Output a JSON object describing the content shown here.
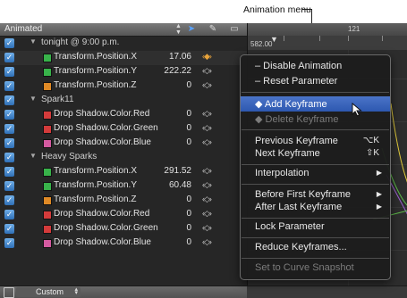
{
  "callout": {
    "label": "Animation menu"
  },
  "header": {
    "filter": "Animated"
  },
  "ruler": {
    "labels": [
      "",
      "121"
    ],
    "readout": "582.00"
  },
  "rows": [
    {
      "type": "group",
      "name": "tonight @ 9:00 p.m."
    },
    {
      "type": "param",
      "name": "Transform.Position.X",
      "value": "17.06",
      "color": "#38b34a",
      "keyframe_active": true
    },
    {
      "type": "param",
      "name": "Transform.Position.Y",
      "value": "222.22",
      "color": "#38b34a"
    },
    {
      "type": "param",
      "name": "Transform.Position.Z",
      "value": "0",
      "color": "#e08a26"
    },
    {
      "type": "group",
      "name": "Spark11"
    },
    {
      "type": "param",
      "name": "Drop Shadow.Color.Red",
      "value": "0",
      "color": "#d43b3b"
    },
    {
      "type": "param",
      "name": "Drop Shadow.Color.Green",
      "value": "0",
      "color": "#d43b3b"
    },
    {
      "type": "param",
      "name": "Drop Shadow.Color.Blue",
      "value": "0",
      "color": "#d45aa0"
    },
    {
      "type": "group",
      "name": "Heavy Sparks"
    },
    {
      "type": "param",
      "name": "Transform.Position.X",
      "value": "291.52",
      "color": "#38b34a"
    },
    {
      "type": "param",
      "name": "Transform.Position.Y",
      "value": "60.48",
      "color": "#38b34a"
    },
    {
      "type": "param",
      "name": "Transform.Position.Z",
      "value": "0",
      "color": "#e08a26"
    },
    {
      "type": "param",
      "name": "Drop Shadow.Color.Red",
      "value": "0",
      "color": "#d43b3b"
    },
    {
      "type": "param",
      "name": "Drop Shadow.Color.Green",
      "value": "0",
      "color": "#d43b3b"
    },
    {
      "type": "param",
      "name": "Drop Shadow.Color.Blue",
      "value": "0",
      "color": "#d45aa0"
    }
  ],
  "footer": {
    "set_label": "Custom"
  },
  "menu": {
    "disable_animation": "– Disable Animation",
    "reset_parameter": "– Reset Parameter",
    "add_keyframe": "◆ Add Keyframe",
    "delete_keyframe": "◆ Delete Keyframe",
    "previous_keyframe": "Previous Keyframe",
    "previous_shortcut": "⌥K",
    "next_keyframe": "Next Keyframe",
    "next_shortcut": "⇧K",
    "interpolation": "Interpolation",
    "before_first": "Before First Keyframe",
    "after_last": "After Last Keyframe",
    "lock_parameter": "Lock Parameter",
    "reduce_keyframes": "Reduce Keyframes...",
    "set_curve_snapshot": "Set to Curve Snapshot"
  }
}
